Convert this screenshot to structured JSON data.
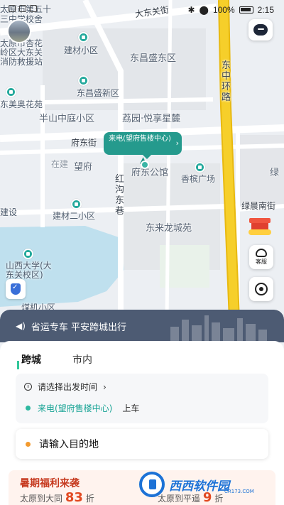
{
  "status_bar": {
    "battery": "100%",
    "time": "2:15"
  },
  "map": {
    "labels": {
      "school_top": "太原市第五十",
      "school_top2": "三中学校舍",
      "fire_station": "太原市杏花\n岭区大东关\n消防救援站",
      "dadongguan_st": "大东关街",
      "jiancai_xiaoqu": "建材小区",
      "dongchang_sheng_east": "东昌盛东区",
      "dongzhong_ring": "东中环路",
      "dongchang_sheng_new": "东昌盛新区",
      "dongmei_aohua": "东美奥花苑",
      "banshan_zhongting": "半山中庭小区",
      "liyuan": "荔园·悦享星麓",
      "fudong_st": "府东街",
      "zaijian": "在建",
      "wangfu": "望府",
      "fudong_gongguan": "府东公馆",
      "xiangheng_square": "香槟广场",
      "lv": "绿",
      "hongou_dongxiang": "红沟东巷",
      "lvchen_nanjie": "绿晨南街",
      "jianshe": "建设",
      "jiancai_erxiaoqu": "建材二小区",
      "donglai_longcheng": "东来龙城苑",
      "shanxi_university": "山西大学(大\n东关校区)",
      "meiji_xiaoqu": "煤机小区"
    },
    "pickup_bubble": "来电(望府售楼中心)",
    "service_label": "客服"
  },
  "panel": {
    "notice": "省运专车 平安跨城出行",
    "tabs": [
      {
        "label": "跨城",
        "active": true
      },
      {
        "label": "市内",
        "active": false
      }
    ],
    "departure_time": "请选择出发时间",
    "start_place": "来电(望府售楼中心)",
    "start_suffix": "上车",
    "destination_placeholder": "请输入目的地",
    "promo": {
      "title": "暑期福利来袭",
      "line1_prefix": "太原到大同",
      "line1_price": "83",
      "line1_suffix": "折",
      "line2_prefix": "太原到平遥",
      "line2_price": "9",
      "line2_suffix": "折"
    }
  },
  "watermark": {
    "text": "西西软件园",
    "sub": "CR173.COM"
  },
  "colors": {
    "accent": "#259a8d",
    "ring_road": "#f6cf2a",
    "notice_bg": "#4d5b73",
    "dest_dot": "#f39a2e"
  }
}
